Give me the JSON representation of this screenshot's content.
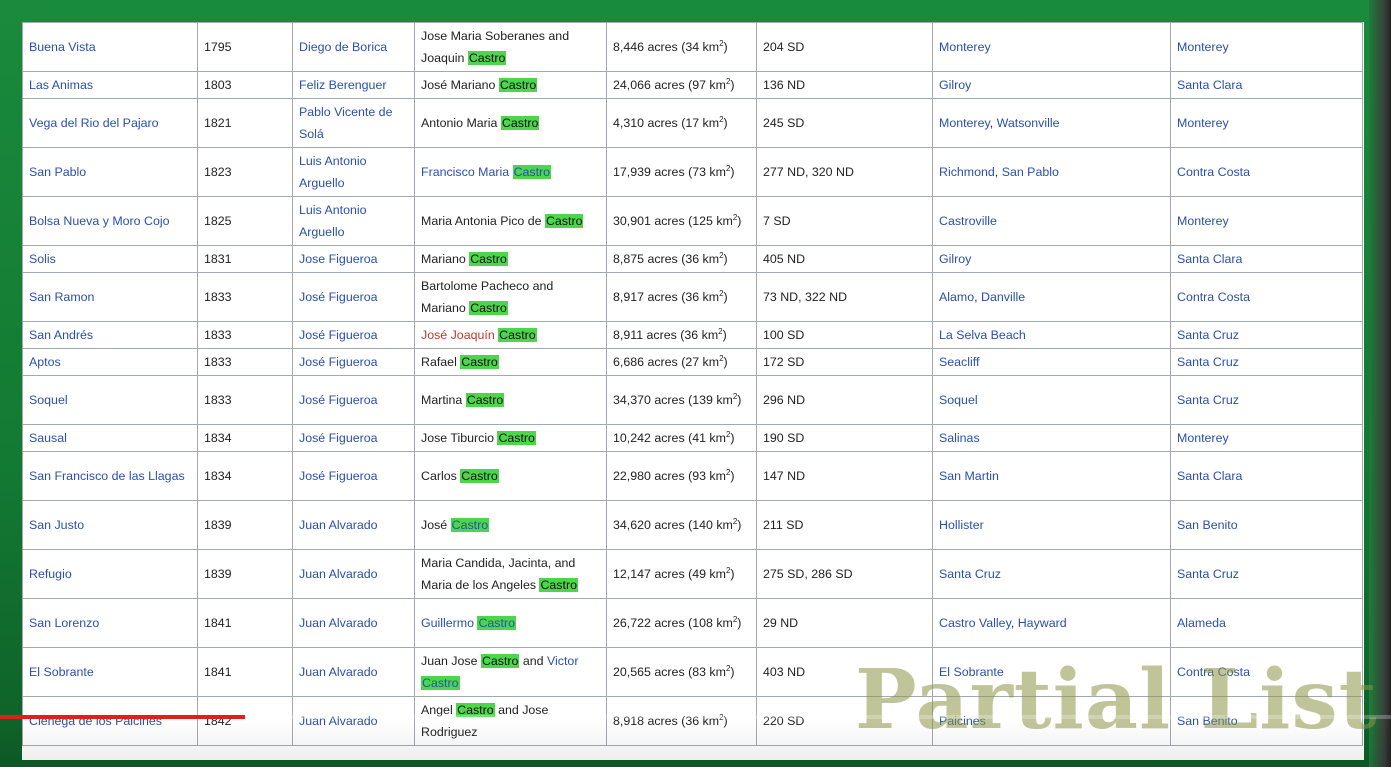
{
  "watermark": "Partial List",
  "progress": {
    "fraction": 0.176
  },
  "colors": {
    "highlight": "#4cd64c",
    "link": "#2a4fae",
    "progress": "#e21d1d",
    "frame": "#137a33"
  },
  "rows": [
    {
      "name": "Buena Vista",
      "year": "1795",
      "grantor": "Diego de Borica",
      "grantee": [
        {
          "t": "Jose Maria Soberanes and Joaquin "
        },
        {
          "t": "Castro",
          "hl": true
        }
      ],
      "area_pre": "8,446 acres (34 km",
      "area_post": ")",
      "ref": "204 SD",
      "cities": [
        {
          "t": "Monterey",
          "link": true
        }
      ],
      "county": "Monterey"
    },
    {
      "name": "Las Animas",
      "year": "1803",
      "grantor": "Feliz Berenguer",
      "grantee": [
        {
          "t": "José Mariano "
        },
        {
          "t": "Castro",
          "hl": true
        }
      ],
      "area_pre": "24,066 acres (97 km",
      "area_post": ")",
      "ref": "136 ND",
      "cities": [
        {
          "t": "Gilroy",
          "link": true
        }
      ],
      "county": "Santa Clara"
    },
    {
      "name": "Vega del Rio del Pajaro",
      "year": "1821",
      "grantor": "Pablo Vicente de Solá",
      "grantee": [
        {
          "t": "Antonio Maria "
        },
        {
          "t": "Castro",
          "hl": true
        }
      ],
      "area_pre": "4,310 acres (17 km",
      "area_post": ")",
      "ref": "245 SD",
      "cities": [
        {
          "t": "Monterey",
          "link": true
        },
        {
          "t": ", "
        },
        {
          "t": "Watsonville",
          "link": true
        }
      ],
      "county": "Monterey"
    },
    {
      "name": "San Pablo",
      "year": "1823",
      "grantor": "Luis Antonio Arguello",
      "grantee": [
        {
          "t": "Francisco Maria ",
          "link": true
        },
        {
          "t": "Castro",
          "hl": true,
          "link": true
        }
      ],
      "area_pre": "17,939 acres (73 km",
      "area_post": ")",
      "ref": "277 ND, 320 ND",
      "cities": [
        {
          "t": "Richmond",
          "link": true
        },
        {
          "t": ", "
        },
        {
          "t": "San Pablo",
          "link": true
        }
      ],
      "county": "Contra Costa"
    },
    {
      "name": "Bolsa Nueva y Moro Cojo",
      "year": "1825",
      "grantor": "Luis Antonio Arguello",
      "grantee": [
        {
          "t": "Maria Antonia Pico de "
        },
        {
          "t": "Castro",
          "hl": true
        }
      ],
      "area_pre": "30,901 acres (125 km",
      "area_post": ")",
      "ref": "7 SD",
      "cities": [
        {
          "t": "Castroville",
          "link": true
        }
      ],
      "county": "Monterey"
    },
    {
      "name": "Solis",
      "year": "1831",
      "grantor": "Jose Figueroa",
      "grantee": [
        {
          "t": "Mariano "
        },
        {
          "t": "Castro",
          "hl": true
        }
      ],
      "area_pre": "8,875 acres (36 km",
      "area_post": ")",
      "ref": "405 ND",
      "cities": [
        {
          "t": "Gilroy",
          "link": true
        }
      ],
      "county": "Santa Clara"
    },
    {
      "name": "San Ramon",
      "year": "1833",
      "grantor": "José Figueroa",
      "grantee": [
        {
          "t": "Bartolome Pacheco and Mariano "
        },
        {
          "t": "Castro",
          "hl": true
        }
      ],
      "area_pre": "8,917 acres (36 km",
      "area_post": ")",
      "ref": "73 ND, 322 ND",
      "cities": [
        {
          "t": "Alamo",
          "link": true
        },
        {
          "t": ", "
        },
        {
          "t": "Danville",
          "link": true
        }
      ],
      "county": "Contra Costa"
    },
    {
      "name": "San Andrés",
      "year": "1833",
      "grantor": "José Figueroa",
      "grantee": [
        {
          "t": "José Joaquín ",
          "red": true
        },
        {
          "t": "Castro",
          "hl": true,
          "red": true
        }
      ],
      "area_pre": "8,911 acres (36 km",
      "area_post": ")",
      "ref": "100 SD",
      "cities": [
        {
          "t": "La Selva Beach",
          "link": true
        }
      ],
      "county": "Santa Cruz"
    },
    {
      "name": "Aptos",
      "year": "1833",
      "grantor": "José Figueroa",
      "grantee": [
        {
          "t": "Rafael "
        },
        {
          "t": "Castro",
          "hl": true
        }
      ],
      "area_pre": "6,686 acres (27 km",
      "area_post": ")",
      "ref": "172 SD",
      "cities": [
        {
          "t": "Seacliff",
          "link": true
        }
      ],
      "county": "Santa Cruz"
    },
    {
      "name": "Soquel",
      "year": "1833",
      "grantor": "José Figueroa",
      "grantee": [
        {
          "t": "Martina "
        },
        {
          "t": "Castro",
          "hl": true
        }
      ],
      "area_pre": "34,370 acres (139 km",
      "area_post": ")",
      "ref": "296 ND",
      "cities": [
        {
          "t": "Soquel",
          "link": true
        }
      ],
      "county": "Santa Cruz"
    },
    {
      "name": "Sausal",
      "year": "1834",
      "grantor": "José Figueroa",
      "grantee": [
        {
          "t": "Jose Tiburcio "
        },
        {
          "t": "Castro",
          "hl": true
        }
      ],
      "area_pre": "10,242 acres (41 km",
      "area_post": ")",
      "ref": "190 SD",
      "cities": [
        {
          "t": "Salinas",
          "link": true
        }
      ],
      "county": "Monterey"
    },
    {
      "name": "San Francisco de las Llagas",
      "year": "1834",
      "grantor": "José Figueroa",
      "grantee": [
        {
          "t": "Carlos "
        },
        {
          "t": "Castro",
          "hl": true
        }
      ],
      "area_pre": "22,980 acres (93 km",
      "area_post": ")",
      "ref": "147 ND",
      "cities": [
        {
          "t": "San Martin",
          "link": true
        }
      ],
      "county": "Santa Clara"
    },
    {
      "name": "San Justo",
      "year": "1839",
      "grantor": "Juan Alvarado",
      "grantee": [
        {
          "t": "José "
        },
        {
          "t": "Castro",
          "hl": true,
          "link": true
        }
      ],
      "area_pre": "34,620 acres (140 km",
      "area_post": ")",
      "ref": "211 SD",
      "cities": [
        {
          "t": "Hollister",
          "link": true
        }
      ],
      "county": "San Benito"
    },
    {
      "name": "Refugio",
      "year": "1839",
      "grantor": "Juan Alvarado",
      "grantee": [
        {
          "t": "Maria Candida, Jacinta, and Maria de los Angeles "
        },
        {
          "t": "Castro",
          "hl": true
        }
      ],
      "area_pre": "12,147 acres (49 km",
      "area_post": ")",
      "ref": "275 SD, 286 SD",
      "cities": [
        {
          "t": "Santa Cruz",
          "link": true
        }
      ],
      "county": "Santa Cruz"
    },
    {
      "name": "San Lorenzo",
      "year": "1841",
      "grantor": "Juan Alvarado",
      "grantee": [
        {
          "t": "Guillermo ",
          "link": true
        },
        {
          "t": "Castro",
          "hl": true,
          "link": true
        }
      ],
      "area_pre": "26,722 acres (108 km",
      "area_post": ")",
      "ref": "29 ND",
      "cities": [
        {
          "t": "Castro Valley",
          "link": true
        },
        {
          "t": ", "
        },
        {
          "t": "Hayward",
          "link": true
        }
      ],
      "county": "Alameda"
    },
    {
      "name": "El Sobrante",
      "year": "1841",
      "grantor": "Juan Alvarado",
      "grantee": [
        {
          "t": "Juan Jose "
        },
        {
          "t": "Castro",
          "hl": true
        },
        {
          "t": " and "
        },
        {
          "t": "Victor ",
          "link": true
        },
        {
          "t": "Castro",
          "hl": true,
          "link": true
        }
      ],
      "area_pre": "20,565 acres (83 km",
      "area_post": ")",
      "ref": "403 ND",
      "cities": [
        {
          "t": "El Sobrante",
          "link": true
        }
      ],
      "county": "Contra Costa"
    },
    {
      "name": "Cienega de los Paicines",
      "year": "1842",
      "grantor": "Juan Alvarado",
      "grantee": [
        {
          "t": "Angel "
        },
        {
          "t": "Castro",
          "hl": true
        },
        {
          "t": " and Jose Rodriguez"
        }
      ],
      "area_pre": "8,918 acres (36 km",
      "area_post": ")",
      "ref": "220 SD",
      "cities": [
        {
          "t": "Paicines",
          "link": true
        }
      ],
      "county": "San Benito"
    }
  ]
}
